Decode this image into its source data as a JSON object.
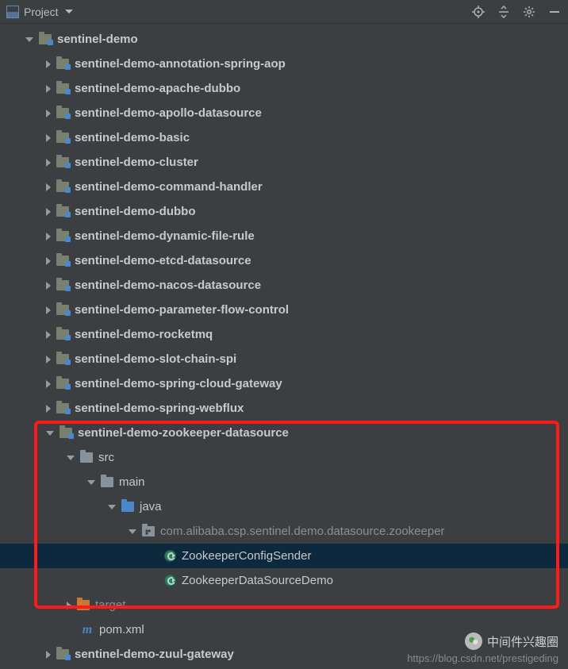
{
  "header": {
    "title": "Project"
  },
  "tree": [
    {
      "depth": 0,
      "arrow": "expanded",
      "icon": "module",
      "label": "sentinel-demo",
      "bold": true,
      "sel": false
    },
    {
      "depth": 1,
      "arrow": "collapsed",
      "icon": "module",
      "label": "sentinel-demo-annotation-spring-aop",
      "bold": true,
      "sel": false
    },
    {
      "depth": 1,
      "arrow": "collapsed",
      "icon": "module",
      "label": "sentinel-demo-apache-dubbo",
      "bold": true,
      "sel": false
    },
    {
      "depth": 1,
      "arrow": "collapsed",
      "icon": "module",
      "label": "sentinel-demo-apollo-datasource",
      "bold": true,
      "sel": false
    },
    {
      "depth": 1,
      "arrow": "collapsed",
      "icon": "module",
      "label": "sentinel-demo-basic",
      "bold": true,
      "sel": false
    },
    {
      "depth": 1,
      "arrow": "collapsed",
      "icon": "module",
      "label": "sentinel-demo-cluster",
      "bold": true,
      "sel": false
    },
    {
      "depth": 1,
      "arrow": "collapsed",
      "icon": "module",
      "label": "sentinel-demo-command-handler",
      "bold": true,
      "sel": false
    },
    {
      "depth": 1,
      "arrow": "collapsed",
      "icon": "module",
      "label": "sentinel-demo-dubbo",
      "bold": true,
      "sel": false
    },
    {
      "depth": 1,
      "arrow": "collapsed",
      "icon": "module",
      "label": "sentinel-demo-dynamic-file-rule",
      "bold": true,
      "sel": false
    },
    {
      "depth": 1,
      "arrow": "collapsed",
      "icon": "module",
      "label": "sentinel-demo-etcd-datasource",
      "bold": true,
      "sel": false
    },
    {
      "depth": 1,
      "arrow": "collapsed",
      "icon": "module",
      "label": "sentinel-demo-nacos-datasource",
      "bold": true,
      "sel": false
    },
    {
      "depth": 1,
      "arrow": "collapsed",
      "icon": "module",
      "label": "sentinel-demo-parameter-flow-control",
      "bold": true,
      "sel": false
    },
    {
      "depth": 1,
      "arrow": "collapsed",
      "icon": "module",
      "label": "sentinel-demo-rocketmq",
      "bold": true,
      "sel": false
    },
    {
      "depth": 1,
      "arrow": "collapsed",
      "icon": "module",
      "label": "sentinel-demo-slot-chain-spi",
      "bold": true,
      "sel": false
    },
    {
      "depth": 1,
      "arrow": "collapsed",
      "icon": "module",
      "label": "sentinel-demo-spring-cloud-gateway",
      "bold": true,
      "sel": false
    },
    {
      "depth": 1,
      "arrow": "collapsed",
      "icon": "module",
      "label": "sentinel-demo-spring-webflux",
      "bold": true,
      "sel": false
    },
    {
      "depth": 1,
      "arrow": "expanded",
      "icon": "module",
      "label": "sentinel-demo-zookeeper-datasource",
      "bold": true,
      "sel": false
    },
    {
      "depth": 2,
      "arrow": "expanded",
      "icon": "plain",
      "label": "src",
      "bold": false,
      "sel": false
    },
    {
      "depth": 3,
      "arrow": "expanded",
      "icon": "plain",
      "label": "main",
      "bold": false,
      "sel": false
    },
    {
      "depth": 4,
      "arrow": "expanded",
      "icon": "src",
      "label": "java",
      "bold": false,
      "sel": false
    },
    {
      "depth": 5,
      "arrow": "expanded",
      "icon": "pkg",
      "label": "com.alibaba.csp.sentinel.demo.datasource.zookeeper",
      "bold": false,
      "muted": true,
      "sel": false
    },
    {
      "depth": 6,
      "arrow": "none",
      "icon": "class",
      "label": "ZookeeperConfigSender",
      "bold": false,
      "sel": true
    },
    {
      "depth": 6,
      "arrow": "none",
      "icon": "class",
      "label": "ZookeeperDataSourceDemo",
      "bold": false,
      "sel": false
    },
    {
      "depth": 2,
      "arrow": "collapsed",
      "icon": "target",
      "label": "target",
      "bold": false,
      "muted": true,
      "sel": false
    },
    {
      "depth": 2,
      "arrow": "none",
      "icon": "maven",
      "label": "pom.xml",
      "bold": false,
      "sel": false
    },
    {
      "depth": 1,
      "arrow": "collapsed",
      "icon": "module",
      "label": "sentinel-demo-zuul-gateway",
      "bold": true,
      "sel": false
    }
  ],
  "watermark": {
    "cn": "中间件兴趣圈",
    "url": "https://blog.csdn.net/prestigeding"
  }
}
